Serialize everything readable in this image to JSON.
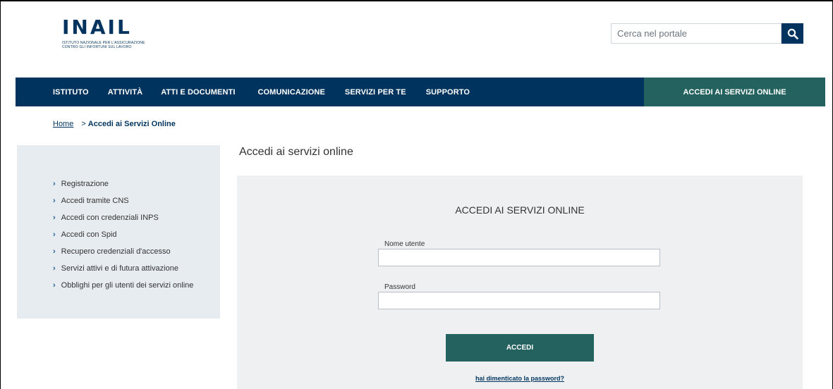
{
  "header": {
    "logo_text": "INAIL",
    "logo_subtitle": "ISTITUTO NAZIONALE PER L'ASSICURAZIONE CONTRO GLI INFORTUNI SUL LAVORO",
    "search_placeholder": "Cerca nel portale",
    "search_icon": "search-icon"
  },
  "nav": {
    "items": [
      "ISTITUTO",
      "ATTIVITÀ",
      "ATTI E DOCUMENTI",
      "COMUNICAZIONE",
      "SERVIZI PER TE",
      "SUPPORTO"
    ],
    "accedi_label": "ACCEDI AI SERVIZI ONLINE"
  },
  "breadcrumb": {
    "home": "Home",
    "separator": ">",
    "current": "Accedi ai Servizi Online"
  },
  "sidebar": {
    "items": [
      "Registrazione",
      "Accedi tramite CNS",
      "Accedi con credenziali INPS",
      "Accedi con Spid",
      "Recupero credenziali d'accesso",
      "Servizi attivi e di futura attivazione",
      "Obblighi per gli utenti dei servizi online"
    ]
  },
  "main": {
    "title": "Accedi ai servizi online",
    "panel_title": "ACCEDI AI SERVIZI ONLINE",
    "username_label": "Nome utente",
    "username_value": "",
    "password_label": "Password",
    "password_value": "",
    "submit_label": "ACCEDI",
    "forgot_label": "hai dimenticato la password?"
  },
  "colors": {
    "primary_navy": "#00345e",
    "accent_teal": "#23625e",
    "sidebar_bg": "#e7ecf1",
    "panel_bg": "#eef0f2"
  }
}
